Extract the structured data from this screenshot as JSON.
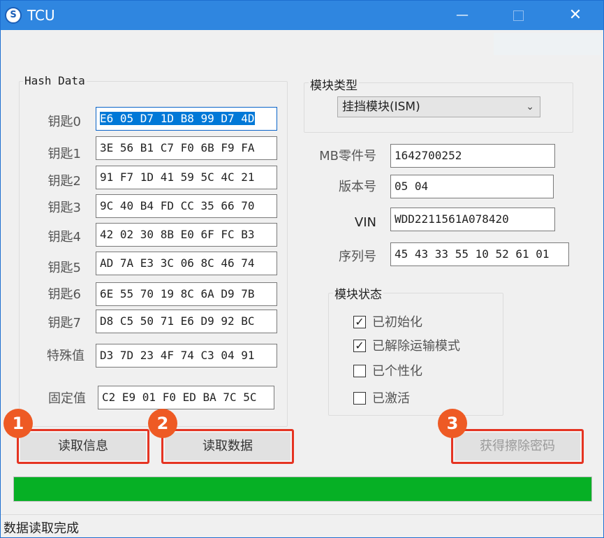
{
  "window": {
    "title": "TCU",
    "app_icon_glyph": "S",
    "min_glyph": "—",
    "close_glyph": "✕"
  },
  "watermark": "",
  "hash_data": {
    "title": "Hash Data",
    "rows": [
      {
        "label": "钥匙0",
        "value": "E6 05 D7 1D B8 99 D7 4D"
      },
      {
        "label": "钥匙1",
        "value": "3E 56 B1 C7 F0 6B F9 FA"
      },
      {
        "label": "钥匙2",
        "value": "91 F7 1D 41 59 5C 4C 21"
      },
      {
        "label": "钥匙3",
        "value": "9C 40 B4 FD CC 35 66 70"
      },
      {
        "label": "钥匙4",
        "value": "42 02 30 8B E0 6F FC B3"
      },
      {
        "label": "钥匙5",
        "value": "AD 7A E3 3C 06 8C 46 74"
      },
      {
        "label": "钥匙6",
        "value": "6E 55 70 19 8C 6A D9 7B"
      },
      {
        "label": "钥匙7",
        "value": "D8 C5 50 71 E6 D9 92 BC"
      },
      {
        "label": "特殊值",
        "value": "D3 7D 23 4F 74 C3 04 91"
      },
      {
        "label": "固定值",
        "value": "C2 E9 01 F0 ED BA 7C 5C"
      }
    ]
  },
  "module_type": {
    "title": "模块类型",
    "selected": "挂挡模块(ISM)"
  },
  "info": {
    "mb_part_label": "MB零件号",
    "mb_part_value": "1642700252",
    "version_label": "版本号",
    "version_value": "05 04",
    "vin_label": "VIN",
    "vin_value": "WDD2211561A078420",
    "serial_label": "序列号",
    "serial_value": "45 43 33 55 10 52 61 01"
  },
  "module_status": {
    "title": "模块状态",
    "items": [
      {
        "label": "已初始化",
        "checked": true
      },
      {
        "label": "已解除运输模式",
        "checked": true
      },
      {
        "label": "已个性化",
        "checked": false
      },
      {
        "label": "已激活",
        "checked": false
      }
    ]
  },
  "buttons": {
    "read_info": "读取信息",
    "read_data": "读取数据",
    "get_erase_password": "获得擦除密码",
    "badge1": "1",
    "badge2": "2",
    "badge3": "3"
  },
  "progress": {
    "percent": 100,
    "color": "#06b025"
  },
  "status_text": "数据读取完成"
}
